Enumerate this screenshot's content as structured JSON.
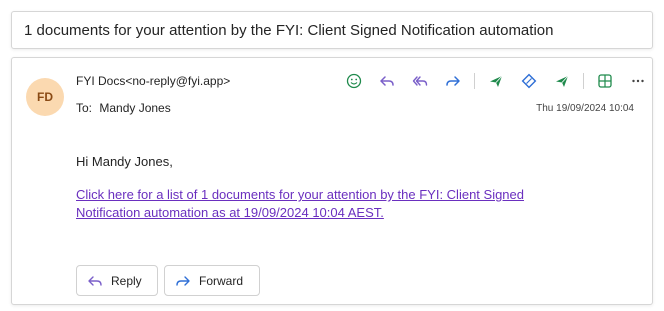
{
  "subject": "1 documents for your attention by the FYI: Client Signed Notification automation",
  "sender": {
    "initials": "FD",
    "name_email": "FYI Docs<no-reply@fyi.app>"
  },
  "recipient": {
    "to_label": "To:",
    "name": "Mandy Jones"
  },
  "timestamp": "Thu 19/09/2024 10:04",
  "body": {
    "greeting": "Hi Mandy Jones,",
    "link_text": "Click here for a list of 1 documents for your attention by the FYI: Client Signed Notification automation as at 19/09/2024 10:04 AEST."
  },
  "actions": {
    "reply_label": "Reply",
    "forward_label": "Forward"
  },
  "toolbar_icons": [
    "emoji-icon",
    "reply-icon",
    "reply-all-icon",
    "forward-icon",
    "send-green-icon",
    "diamond-icon",
    "send-green-icon-2",
    "grid-icon",
    "more-icon"
  ],
  "colors": {
    "avatar_bg": "#fbd9b0",
    "avatar_text": "#8a4a14",
    "link": "#6a2fbf",
    "accent_purple": "#7a5fc9",
    "accent_blue": "#2f6fd6",
    "accent_green": "#1f8a4c"
  }
}
